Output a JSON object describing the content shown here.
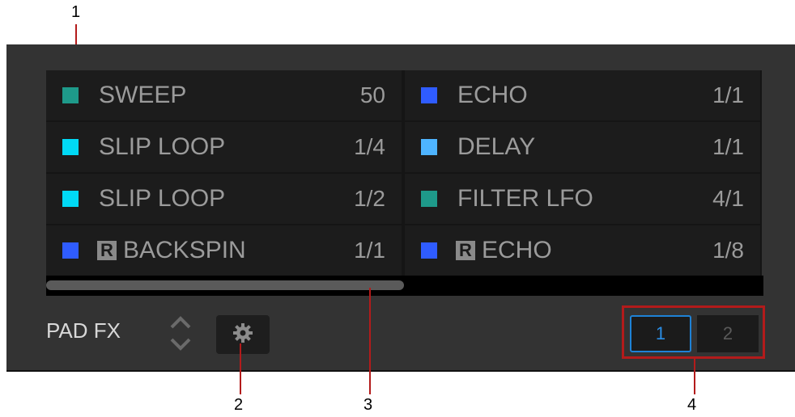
{
  "callouts": [
    "1",
    "2",
    "3",
    "4"
  ],
  "pads": [
    {
      "name": "SWEEP",
      "value": "50",
      "color": "#1e9a8a",
      "reverse": false
    },
    {
      "name": "ECHO",
      "value": "1/1",
      "color": "#2f5cff",
      "reverse": false
    },
    {
      "name": "SLIP LOOP",
      "value": "1/4",
      "color": "#00d9f5",
      "reverse": false
    },
    {
      "name": "DELAY",
      "value": "1/1",
      "color": "#4eb4ff",
      "reverse": false
    },
    {
      "name": "SLIP LOOP",
      "value": "1/2",
      "color": "#00d9f5",
      "reverse": false
    },
    {
      "name": "FILTER LFO",
      "value": "4/1",
      "color": "#1e9a8a",
      "reverse": false
    },
    {
      "name": "BACKSPIN",
      "value": "1/1",
      "color": "#2f5cff",
      "reverse": true
    },
    {
      "name": "ECHO",
      "value": "1/8",
      "color": "#2f5cff",
      "reverse": true
    }
  ],
  "reverse_badge": "R",
  "footer": {
    "label": "PAD FX",
    "pages": [
      "1",
      "2"
    ],
    "active_page": "1"
  },
  "icons": {
    "up": "chevron-up-icon",
    "down": "chevron-down-icon",
    "settings": "gear-icon"
  }
}
